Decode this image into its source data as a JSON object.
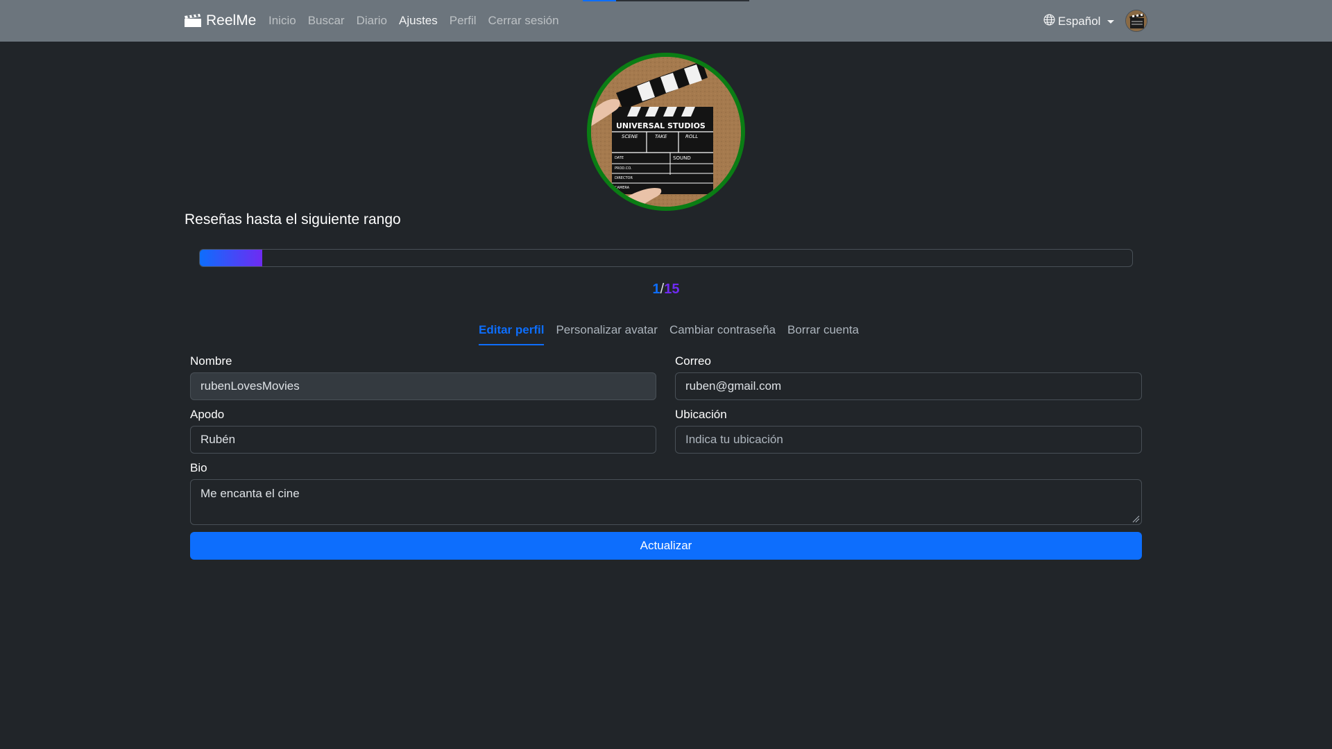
{
  "nav": {
    "brand": "ReelMe",
    "links": [
      "Inicio",
      "Buscar",
      "Diario",
      "Ajustes",
      "Perfil",
      "Cerrar sesión"
    ],
    "active_link": "Ajustes",
    "language": "Español"
  },
  "profile": {
    "avatar_icon": "clapperboard-photo",
    "ring_color": "#0a7d14"
  },
  "rank": {
    "title": "Reseñas hasta el siguiente rango",
    "current": "1",
    "separator": "/",
    "total": "15",
    "progress_fraction": 0.0667
  },
  "tabs": [
    "Editar perfil",
    "Personalizar avatar",
    "Cambiar contraseña",
    "Borrar cuenta"
  ],
  "form": {
    "name_label": "Nombre",
    "name_value": "rubenLovesMovies",
    "email_label": "Correo",
    "email_value": "ruben@gmail.com",
    "nickname_label": "Apodo",
    "nickname_value": "Rubén",
    "location_label": "Ubicación",
    "location_placeholder": "Indica tu ubicación",
    "bio_label": "Bio",
    "bio_value": "Me encanta el cine",
    "submit_label": "Actualizar"
  },
  "colors": {
    "accent": "#0d6efd",
    "accent_purple": "#6f2bf2",
    "navbar": "#6c757d",
    "background": "#212529"
  }
}
